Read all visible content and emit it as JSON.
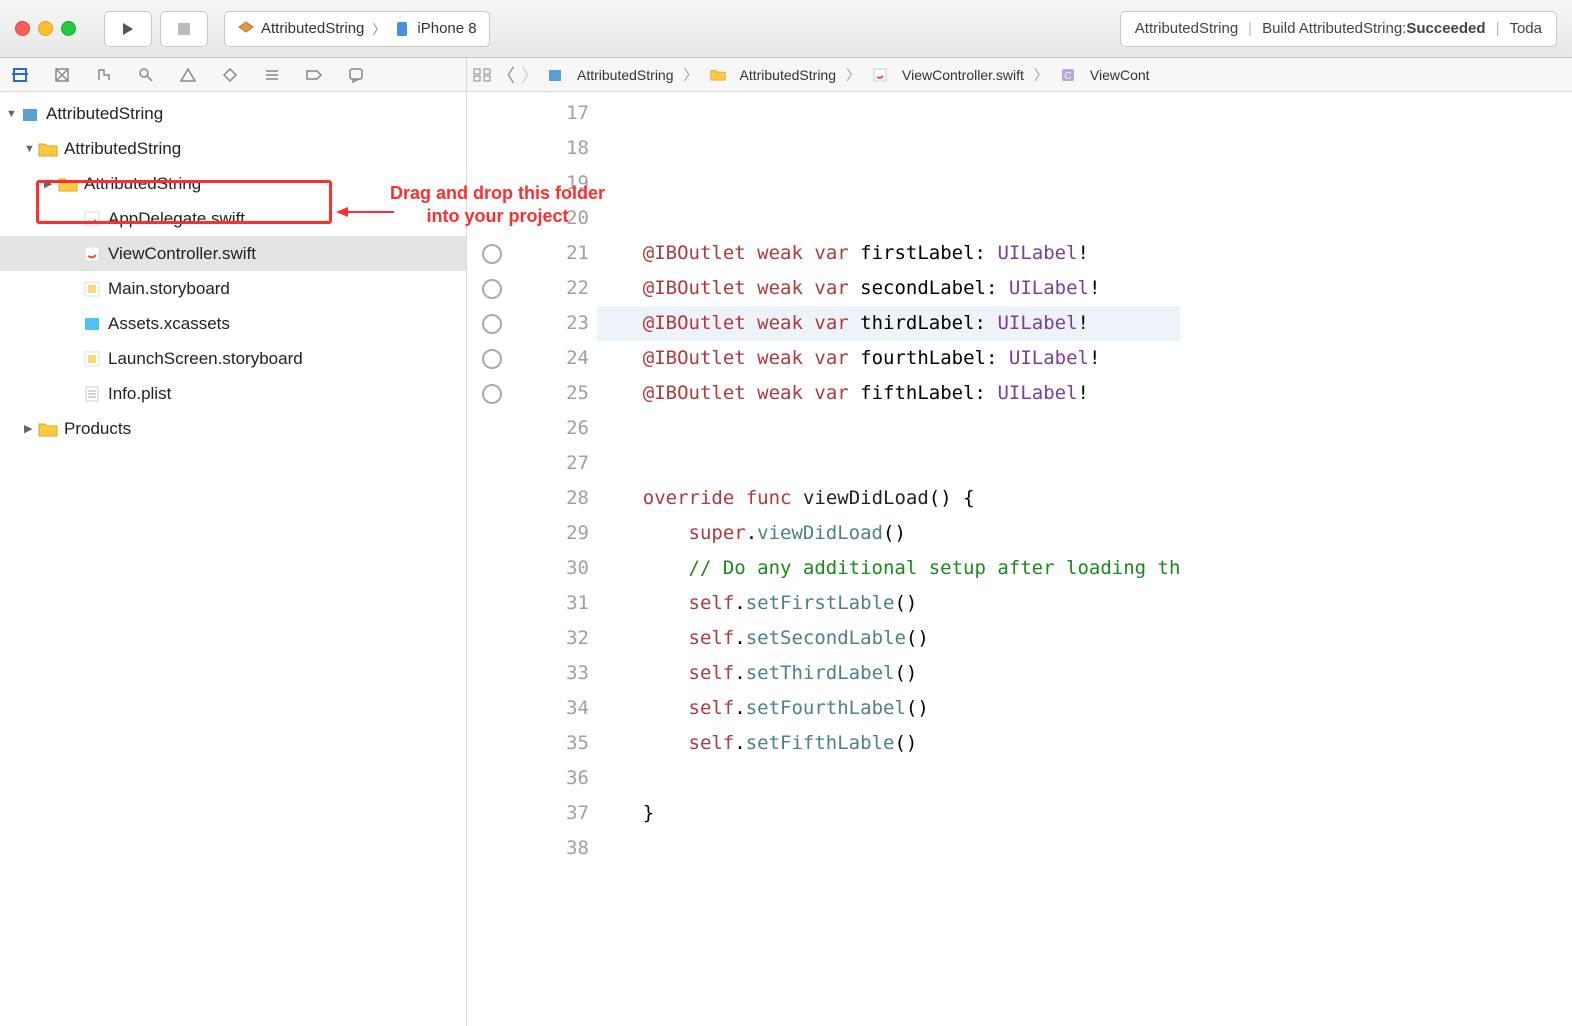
{
  "toolbar": {
    "scheme_project": "AttributedString",
    "scheme_device": "iPhone 8"
  },
  "build_status": {
    "project": "AttributedString",
    "build_prefix": "Build AttributedString: ",
    "build_result": "Succeeded",
    "time": "Toda"
  },
  "annotation": {
    "line1": "Drag and drop this folder",
    "line2": "into your project"
  },
  "tree": {
    "root": "AttributedString",
    "group1": "AttributedString",
    "folder": "AttributedString",
    "files": [
      "AppDelegate.swift",
      "ViewController.swift",
      "Main.storyboard",
      "Assets.xcassets",
      "LaunchScreen.storyboard",
      "Info.plist"
    ],
    "products": "Products"
  },
  "jumpbar": {
    "p1": "AttributedString",
    "p2": "AttributedString",
    "p3": "ViewController.swift",
    "p4": "ViewCont"
  },
  "code": {
    "gutter_start": 17,
    "lines": [
      {
        "n": 17,
        "t": "    "
      },
      {
        "n": 18,
        "t": ""
      },
      {
        "n": 19,
        "t": ""
      },
      {
        "n": 20,
        "t": "    "
      },
      {
        "n": 21,
        "bp": true,
        "tok": [
          {
            "c": "    "
          },
          {
            "c": "@IBOutlet",
            "s": "kw-attr"
          },
          {
            "c": " "
          },
          {
            "c": "weak",
            "s": "kw"
          },
          {
            "c": " "
          },
          {
            "c": "var",
            "s": "kw"
          },
          {
            "c": " firstLabel: "
          },
          {
            "c": "UILabel",
            "s": "type"
          },
          {
            "c": "!"
          }
        ]
      },
      {
        "n": 22,
        "bp": true,
        "tok": [
          {
            "c": "    "
          },
          {
            "c": "@IBOutlet",
            "s": "kw-attr"
          },
          {
            "c": " "
          },
          {
            "c": "weak",
            "s": "kw"
          },
          {
            "c": " "
          },
          {
            "c": "var",
            "s": "kw"
          },
          {
            "c": " secondLabel: "
          },
          {
            "c": "UILabel",
            "s": "type"
          },
          {
            "c": "!"
          }
        ]
      },
      {
        "n": 23,
        "bp": true,
        "hl": true,
        "tok": [
          {
            "c": "    "
          },
          {
            "c": "@IBOutlet",
            "s": "kw-attr"
          },
          {
            "c": " "
          },
          {
            "c": "weak",
            "s": "kw"
          },
          {
            "c": " "
          },
          {
            "c": "var",
            "s": "kw"
          },
          {
            "c": " thirdLabel: "
          },
          {
            "c": "UILabel",
            "s": "type"
          },
          {
            "c": "!"
          }
        ]
      },
      {
        "n": 24,
        "bp": true,
        "tok": [
          {
            "c": "    "
          },
          {
            "c": "@IBOutlet",
            "s": "kw-attr"
          },
          {
            "c": " "
          },
          {
            "c": "weak",
            "s": "kw"
          },
          {
            "c": " "
          },
          {
            "c": "var",
            "s": "kw"
          },
          {
            "c": " fourthLabel: "
          },
          {
            "c": "UILabel",
            "s": "type"
          },
          {
            "c": "!"
          }
        ]
      },
      {
        "n": 25,
        "bp": true,
        "tok": [
          {
            "c": "    "
          },
          {
            "c": "@IBOutlet",
            "s": "kw-attr"
          },
          {
            "c": " "
          },
          {
            "c": "weak",
            "s": "kw"
          },
          {
            "c": " "
          },
          {
            "c": "var",
            "s": "kw"
          },
          {
            "c": " fifthLabel: "
          },
          {
            "c": "UILabel",
            "s": "type"
          },
          {
            "c": "!"
          }
        ]
      },
      {
        "n": 26,
        "t": "    "
      },
      {
        "n": 27,
        "t": ""
      },
      {
        "n": 28,
        "tok": [
          {
            "c": "    "
          },
          {
            "c": "override",
            "s": "kw"
          },
          {
            "c": " "
          },
          {
            "c": "func",
            "s": "kw"
          },
          {
            "c": " "
          },
          {
            "c": "viewDidLoad",
            "s": "ident"
          },
          {
            "c": "() {"
          }
        ]
      },
      {
        "n": 29,
        "tok": [
          {
            "c": "        "
          },
          {
            "c": "super",
            "s": "kw"
          },
          {
            "c": "."
          },
          {
            "c": "viewDidLoad",
            "s": "method"
          },
          {
            "c": "()"
          }
        ]
      },
      {
        "n": 30,
        "tok": [
          {
            "c": "        "
          },
          {
            "c": "// Do any additional setup after loading th",
            "s": "comment"
          }
        ]
      },
      {
        "n": 31,
        "tok": [
          {
            "c": "        "
          },
          {
            "c": "self",
            "s": "self"
          },
          {
            "c": "."
          },
          {
            "c": "setFirstLable",
            "s": "method"
          },
          {
            "c": "()"
          }
        ]
      },
      {
        "n": 32,
        "tok": [
          {
            "c": "        "
          },
          {
            "c": "self",
            "s": "self"
          },
          {
            "c": "."
          },
          {
            "c": "setSecondLable",
            "s": "method"
          },
          {
            "c": "()"
          }
        ]
      },
      {
        "n": 33,
        "tok": [
          {
            "c": "        "
          },
          {
            "c": "self",
            "s": "self"
          },
          {
            "c": "."
          },
          {
            "c": "setThirdLabel",
            "s": "method"
          },
          {
            "c": "()"
          }
        ]
      },
      {
        "n": 34,
        "tok": [
          {
            "c": "        "
          },
          {
            "c": "self",
            "s": "self"
          },
          {
            "c": "."
          },
          {
            "c": "setFourthLabel",
            "s": "method"
          },
          {
            "c": "()"
          }
        ]
      },
      {
        "n": 35,
        "tok": [
          {
            "c": "        "
          },
          {
            "c": "self",
            "s": "self"
          },
          {
            "c": "."
          },
          {
            "c": "setFifthLable",
            "s": "method"
          },
          {
            "c": "()"
          }
        ]
      },
      {
        "n": 36,
        "t": "    "
      },
      {
        "n": 37,
        "t": "    }"
      },
      {
        "n": 38,
        "t": ""
      }
    ]
  }
}
